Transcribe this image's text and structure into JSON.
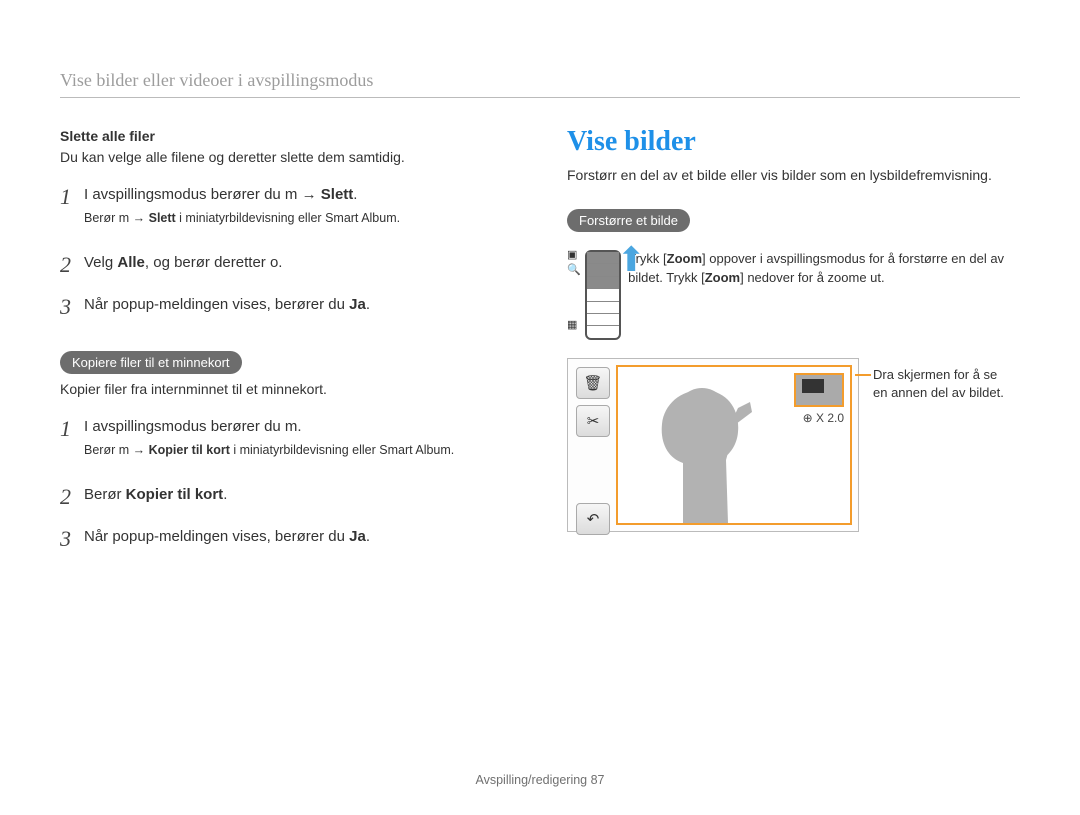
{
  "header": "Vise bilder eller videoer i avspillingsmodus",
  "left": {
    "delete_all": {
      "heading": "Slette alle filer",
      "desc": "Du kan velge alle filene og deretter slette dem samtidig.",
      "steps": {
        "s1_a": "I avspillingsmodus berører du ",
        "s1_menu": "m",
        "s1_arrow": " → ",
        "s1_b": "Slett",
        "s1_dot": ".",
        "s1_note_a": "Berør ",
        "s1_note_menu": "m",
        "s1_note_arrow": " → ",
        "s1_note_b": "Slett",
        "s1_note_c": " i miniatyrbildevisning eller Smart Album.",
        "s2_a": "Velg ",
        "s2_b": "Alle",
        "s2_c": ", og berør deretter ",
        "s2_ok": "o",
        "s2_dot": ".",
        "s3_a": "Når popup-meldingen vises, berører du ",
        "s3_b": "Ja",
        "s3_dot": "."
      }
    },
    "copy": {
      "pill": "Kopiere filer til et minnekort",
      "desc": "Kopier filer fra internminnet til et minnekort.",
      "steps": {
        "s1_a": "I avspillingsmodus berører du ",
        "s1_menu": "m",
        "s1_dot": ".",
        "s1_note_a": "Berør ",
        "s1_note_menu": "m",
        "s1_note_arrow": " → ",
        "s1_note_b": "Kopier til kort",
        "s1_note_c": " i miniatyrbildevisning eller Smart Album.",
        "s2_a": "Berør ",
        "s2_b": "Kopier til kort",
        "s2_dot": ".",
        "s3_a": "Når popup-meldingen vises, berører du ",
        "s3_b": "Ja",
        "s3_dot": "."
      }
    }
  },
  "right": {
    "title": "Vise bilder",
    "intro": "Forstørr en del av et bilde eller vis bilder som en lysbildefremvisning.",
    "enlarge_pill": "Forstørre et bilde",
    "zoom_text_a": "Trykk [",
    "zoom_text_b": "Zoom",
    "zoom_text_c": "] oppover i avspillingsmodus for å forstørre en del av bildet. Trykk [",
    "zoom_text_d": "Zoom",
    "zoom_text_e": "] nedover for å zoome ut.",
    "zoom_label_icon": "⊕",
    "zoom_label": " X 2.0",
    "callout": "Dra skjermen for å se en annen del av bildet."
  },
  "footer": {
    "text": "Avspilling/redigering  87"
  }
}
